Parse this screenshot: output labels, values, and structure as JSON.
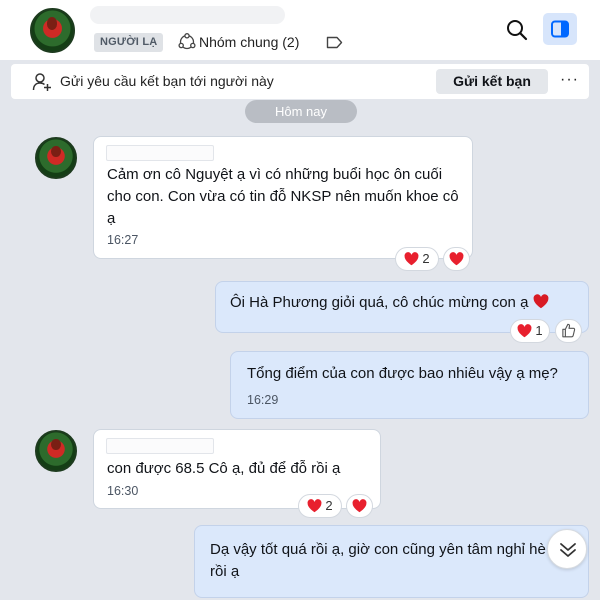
{
  "header": {
    "stranger_badge": "NGƯỜI LẠ",
    "group_label": "Nhóm chung (2)"
  },
  "friend_request": {
    "text": "Gửi yêu cầu kết bạn tới người này",
    "button_label": "Gửi kết bạn",
    "more_label": "···"
  },
  "date_divider": "Hôm nay",
  "messages": [
    {
      "direction": "incoming",
      "text": "Cảm ơn cô Nguyệt ạ vì có những buổi học ôn cuối cho con. Con vừa có tin đỗ NKSP nên muốn khoe cô ạ",
      "time": "16:27",
      "reaction_count": "2"
    },
    {
      "direction": "outgoing",
      "text": "Ôi Hà Phương giỏi quá, cô chúc mừng con ạ",
      "reaction_count": "1"
    },
    {
      "direction": "outgoing",
      "text": "Tổng điểm của con được bao nhiêu vậy ạ mẹ?",
      "time": "16:29"
    },
    {
      "direction": "incoming",
      "text": "con được 68.5 Cô ạ, đủ để đỗ rồi ạ",
      "time": "16:30",
      "reaction_count": "2"
    },
    {
      "direction": "outgoing",
      "text": "Dạ vậy tốt quá rồi ạ, giờ con cũng yên tâm nghỉ hè rồi ạ"
    }
  ],
  "colors": {
    "heart": "#e8202e",
    "accent": "#0068ff",
    "outgoing_bubble": "#dbe8fb",
    "incoming_bubble": "#ffffff",
    "background": "#e3e6ec"
  },
  "icons": [
    "avatar",
    "group-icon",
    "tag-icon",
    "search-icon",
    "sidebar-toggle-icon",
    "add-friend-icon",
    "more-icon",
    "heart-icon",
    "thumbs-up-icon",
    "chevron-down-double-icon"
  ]
}
